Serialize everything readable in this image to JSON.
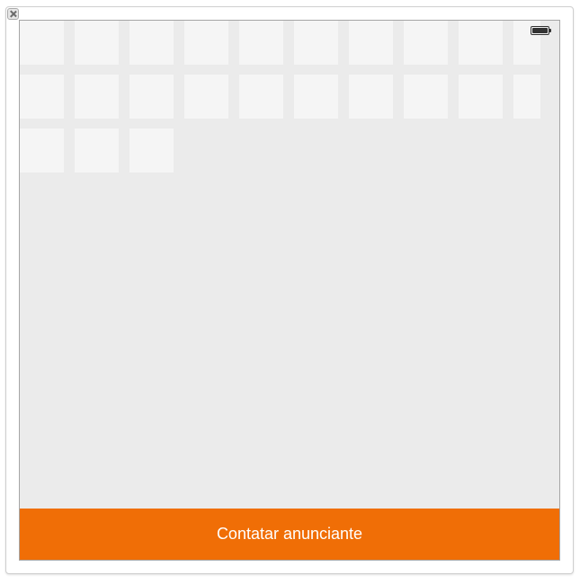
{
  "window": {
    "close_icon": "close-icon"
  },
  "status_bar": {
    "battery_icon": "battery-icon",
    "battery_level": 1.0
  },
  "photo_grid": {
    "tile_count": 23
  },
  "footer": {
    "contact_label": "Contatar anunciante",
    "contact_color": "#f06e06"
  }
}
